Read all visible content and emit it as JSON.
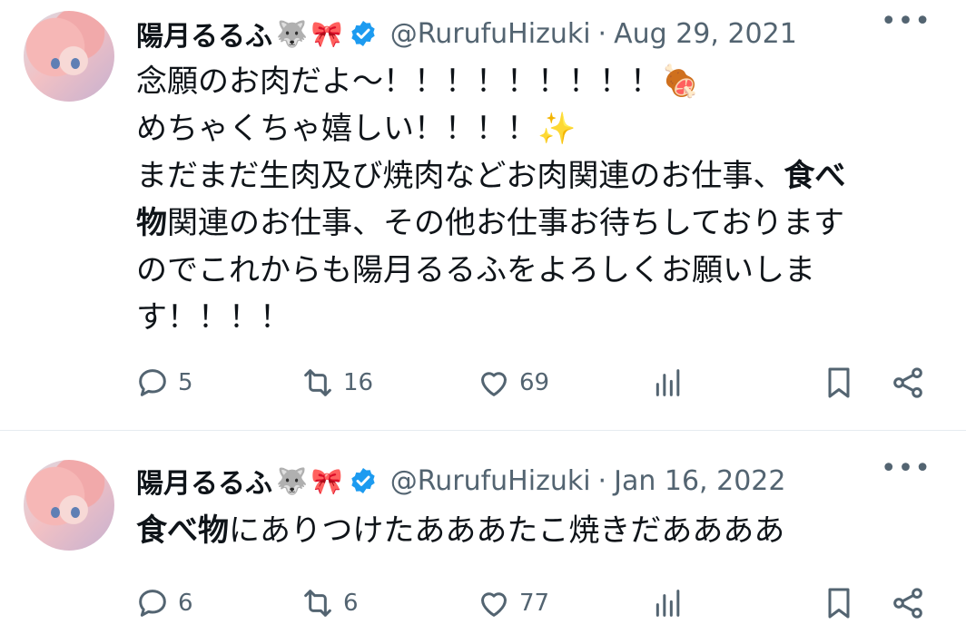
{
  "tweets": [
    {
      "display_name": "陽月るるふ",
      "name_emojis": [
        "🐺",
        "🎀"
      ],
      "handle": "@RurufuHizuki",
      "date": "Aug 29, 2021",
      "lines": [
        {
          "text": "念願のお肉だよ〜！！！！！！！！！",
          "emoji": "🍖"
        },
        {
          "text": "めちゃくちゃ嬉しい！！！！",
          "emoji": "✨"
        },
        {
          "segments": [
            {
              "text": "まだまだ生肉及び焼肉などお肉関連のお仕事、",
              "bold": false
            },
            {
              "text": "食べ",
              "bold": true
            }
          ]
        },
        {
          "segments": [
            {
              "text": "物",
              "bold": true
            },
            {
              "text": "関連のお仕事、その他お仕事お待ちしております",
              "bold": false
            }
          ]
        },
        {
          "text": "のでこれからも陽月るるふをよろしくお願いしま"
        },
        {
          "text": "す！！！！"
        }
      ],
      "replies": "5",
      "retweets": "16",
      "likes": "69"
    },
    {
      "display_name": "陽月るるふ",
      "name_emojis": [
        "🐺",
        "🎀"
      ],
      "handle": "@RurufuHizuki",
      "date": "Jan 16, 2022",
      "lines": [
        {
          "segments": [
            {
              "text": "食べ物",
              "bold": true
            },
            {
              "text": "にありつけたあああたこ焼きだああああ",
              "bold": false
            }
          ]
        }
      ],
      "replies": "6",
      "retweets": "6",
      "likes": "77"
    }
  ],
  "icons": {
    "verified": "verified-badge-icon",
    "more": "more-icon",
    "reply": "reply-icon",
    "retweet": "retweet-icon",
    "like": "heart-icon",
    "views": "views-icon",
    "bookmark": "bookmark-icon",
    "share": "share-icon"
  },
  "colors": {
    "text": "#0f1419",
    "secondary": "#536471",
    "verified": "#1d9bf0",
    "divider": "#e6ecf0"
  },
  "more_label": "•••"
}
